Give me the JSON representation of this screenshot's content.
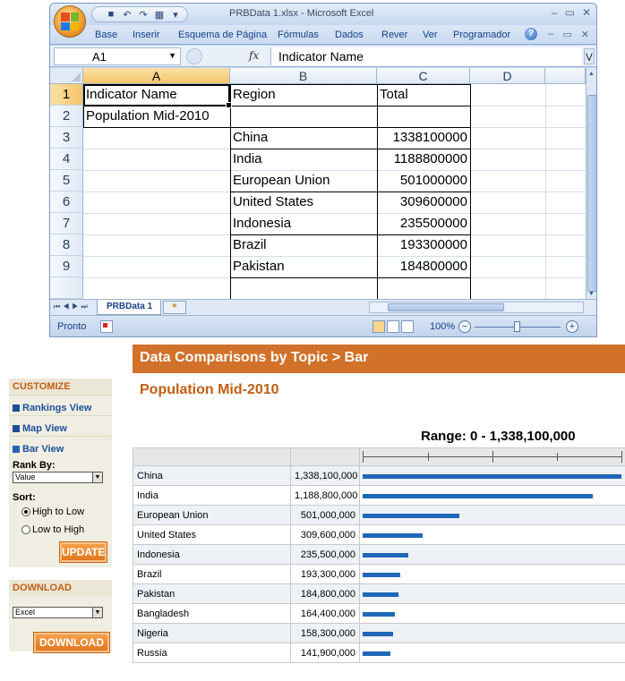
{
  "excel": {
    "title": "PRBData 1.xlsx - Microsoft Excel",
    "ribbon_tabs": [
      "Base",
      "Inserir",
      "Esquema de Página",
      "Fórmulas",
      "Dados",
      "Rever",
      "Ver",
      "Programador"
    ],
    "name_box": "A1",
    "fx_label": "fx",
    "formula_value": "Indicator Name",
    "col_headers": [
      "A",
      "B",
      "C",
      "D"
    ],
    "row_headers": [
      "1",
      "2",
      "3",
      "4",
      "5",
      "6",
      "7",
      "8",
      "9"
    ],
    "cells": {
      "a1": "Indicator Name",
      "b1": "Region",
      "c1": "Total",
      "a2": "Population Mid-2010",
      "b3": "China",
      "c3": "1338100000",
      "b4": "India",
      "c4": "1188800000",
      "b5": "European Union",
      "c5": "501000000",
      "b6": "United States",
      "c6": "309600000",
      "b7": "Indonesia",
      "c7": "235500000",
      "b8": "Brazil",
      "c8": "193300000",
      "b9": "Pakistan",
      "c9": "184800000"
    },
    "sheet_tab": "PRBData 1",
    "status": "Pronto",
    "zoom": "100%"
  },
  "web": {
    "banner": "Data Comparisons by Topic > Bar",
    "subtitle": "Population Mid-2010",
    "range_label": "Range: 0 - 1,338,100,000",
    "customize_head": "CUSTOMIZE",
    "links": [
      "Rankings View",
      "Map View",
      "Bar View"
    ],
    "rank_by_label": "Rank By:",
    "rank_by_value": "Value",
    "sort_label": "Sort:",
    "sort_options": [
      "High to Low",
      "Low to High"
    ],
    "update_btn": "UPDATE",
    "download_head": "DOWNLOAD",
    "download_format": "Excel",
    "download_btn": "DOWNLOAD",
    "max_value": 1338100000,
    "rows": [
      {
        "region": "China",
        "value": "1,338,100,000",
        "v": 1338100000
      },
      {
        "region": "India",
        "value": "1,188,800,000",
        "v": 1188800000
      },
      {
        "region": "European Union",
        "value": "501,000,000",
        "v": 501000000
      },
      {
        "region": "United States",
        "value": "309,600,000",
        "v": 309600000
      },
      {
        "region": "Indonesia",
        "value": "235,500,000",
        "v": 235500000
      },
      {
        "region": "Brazil",
        "value": "193,300,000",
        "v": 193300000
      },
      {
        "region": "Pakistan",
        "value": "184,800,000",
        "v": 184800000
      },
      {
        "region": "Bangladesh",
        "value": "164,400,000",
        "v": 164400000
      },
      {
        "region": "Nigeria",
        "value": "158,300,000",
        "v": 158300000
      },
      {
        "region": "Russia",
        "value": "141,900,000",
        "v": 141900000
      }
    ]
  }
}
